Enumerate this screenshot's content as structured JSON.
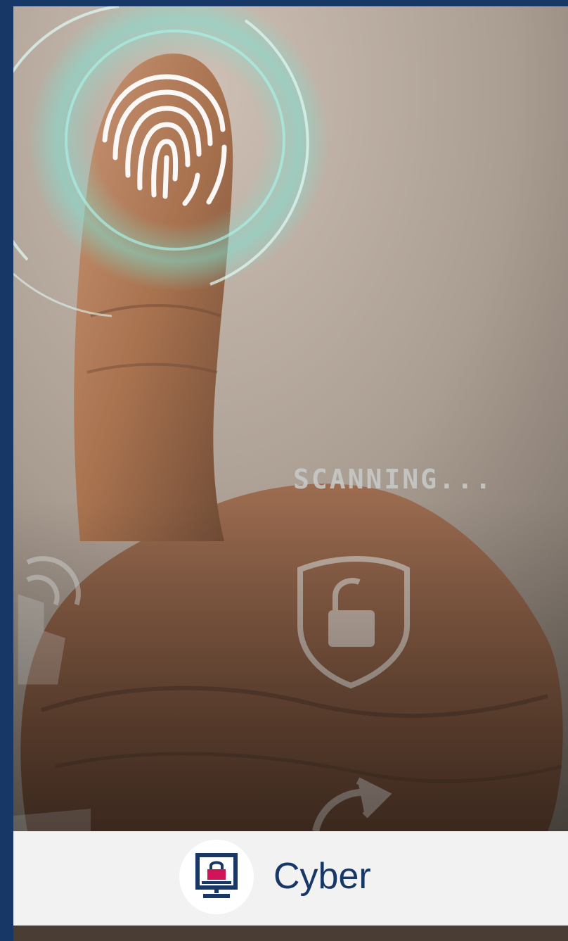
{
  "hero": {
    "scan_text": "SCANNING...",
    "icons": [
      "fingerprint-icon",
      "unlock-shield-icon",
      "touch-icon",
      "refresh-icon"
    ]
  },
  "category": {
    "label": "Cyber",
    "icon": "monitor-lock-icon"
  },
  "colors": {
    "frame": "#173766",
    "footer_bg": "#f2f2f2",
    "label": "#173766",
    "icon_accent": "#d2135a"
  }
}
